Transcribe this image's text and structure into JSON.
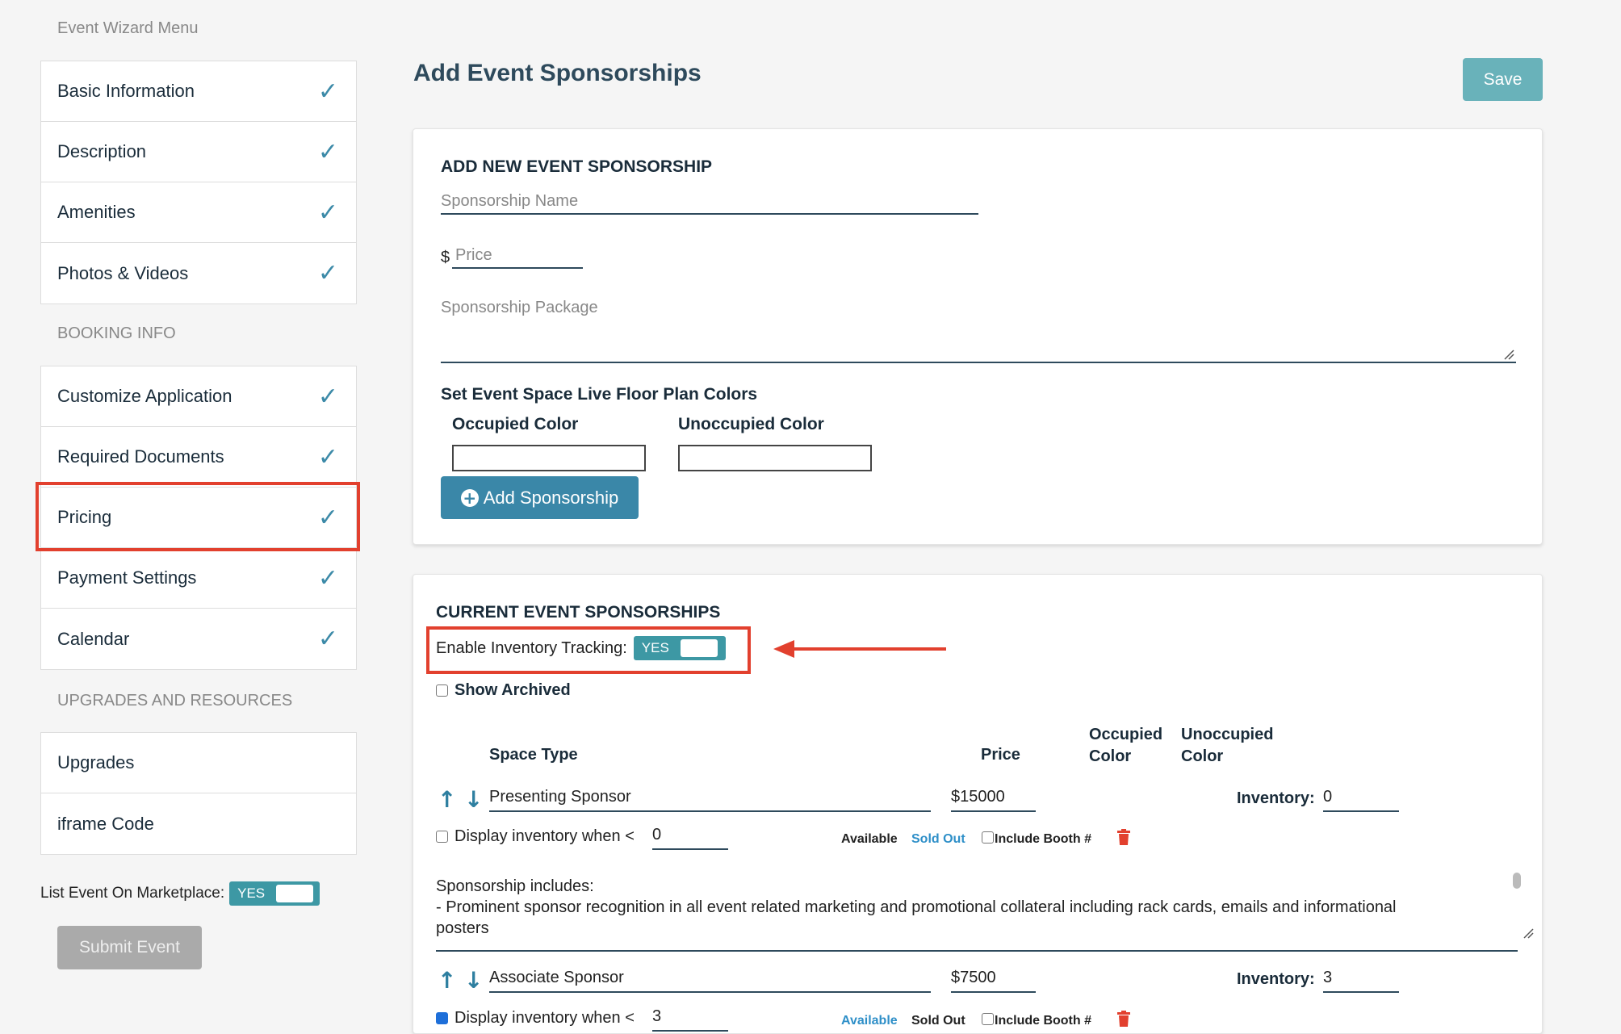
{
  "sidebar": {
    "title": "Event Wizard Menu",
    "group1": [
      "Basic Information",
      "Description",
      "Amenities",
      "Photos & Videos"
    ],
    "booking_title": "BOOKING INFO",
    "group2": [
      "Customize Application",
      "Required Documents",
      "Pricing",
      "Payment Settings",
      "Calendar"
    ],
    "upgrades_title": "UPGRADES AND RESOURCES",
    "group3": [
      "Upgrades",
      "iframe Code"
    ],
    "check_glyph": "✓",
    "marketplace_label": "List Event On Marketplace:",
    "marketplace_toggle": "YES",
    "submit_label": "Submit Event"
  },
  "header": {
    "title": "Add Event Sponsorships",
    "save_label": "Save"
  },
  "add_form": {
    "title": "ADD NEW EVENT SPONSORSHIP",
    "name_placeholder": "Sponsorship Name",
    "currency": "$",
    "price_placeholder": "Price",
    "package_placeholder": "Sponsorship Package",
    "colors_title": "Set Event Space Live Floor Plan Colors",
    "occupied_label": "Occupied Color",
    "unoccupied_label": "Unoccupied Color",
    "add_button": "Add Sponsorship"
  },
  "current": {
    "title": "CURRENT EVENT SPONSORSHIPS",
    "inventory_label": "Enable Inventory Tracking:",
    "inventory_toggle": "YES",
    "show_archived": "Show Archived",
    "columns": {
      "space_type": "Space Type",
      "price": "Price",
      "occupied_1": "Occupied",
      "occupied_2": "Color",
      "unoccupied_1": "Unoccupied",
      "unoccupied_2": "Color"
    },
    "rows": [
      {
        "name": "Presenting Sponsor",
        "price": "$15000",
        "inventory_label": "Inventory:",
        "inventory": "0",
        "display_label": "Display inventory when <",
        "display_value": "0",
        "available": "Available",
        "sold_out": "Sold Out",
        "include_booth": "Include Booth #",
        "includes_1": "Sponsorship includes:",
        "includes_2": "- Prominent sponsor recognition in all event related marketing and promotional collateral including rack cards, emails and informational",
        "includes_3": "posters"
      },
      {
        "name": "Associate Sponsor",
        "price": "$7500",
        "inventory_label": "Inventory:",
        "inventory": "3",
        "display_label": "Display inventory when <",
        "display_value": "3",
        "available": "Available",
        "sold_out": "Sold Out",
        "include_booth": "Include Booth #"
      }
    ]
  },
  "colors": {
    "accent": "#3a87a8",
    "toggle": "#3d98a4",
    "highlight": "#e2402e",
    "delete": "#e2402e",
    "link": "#2e8fc8"
  }
}
